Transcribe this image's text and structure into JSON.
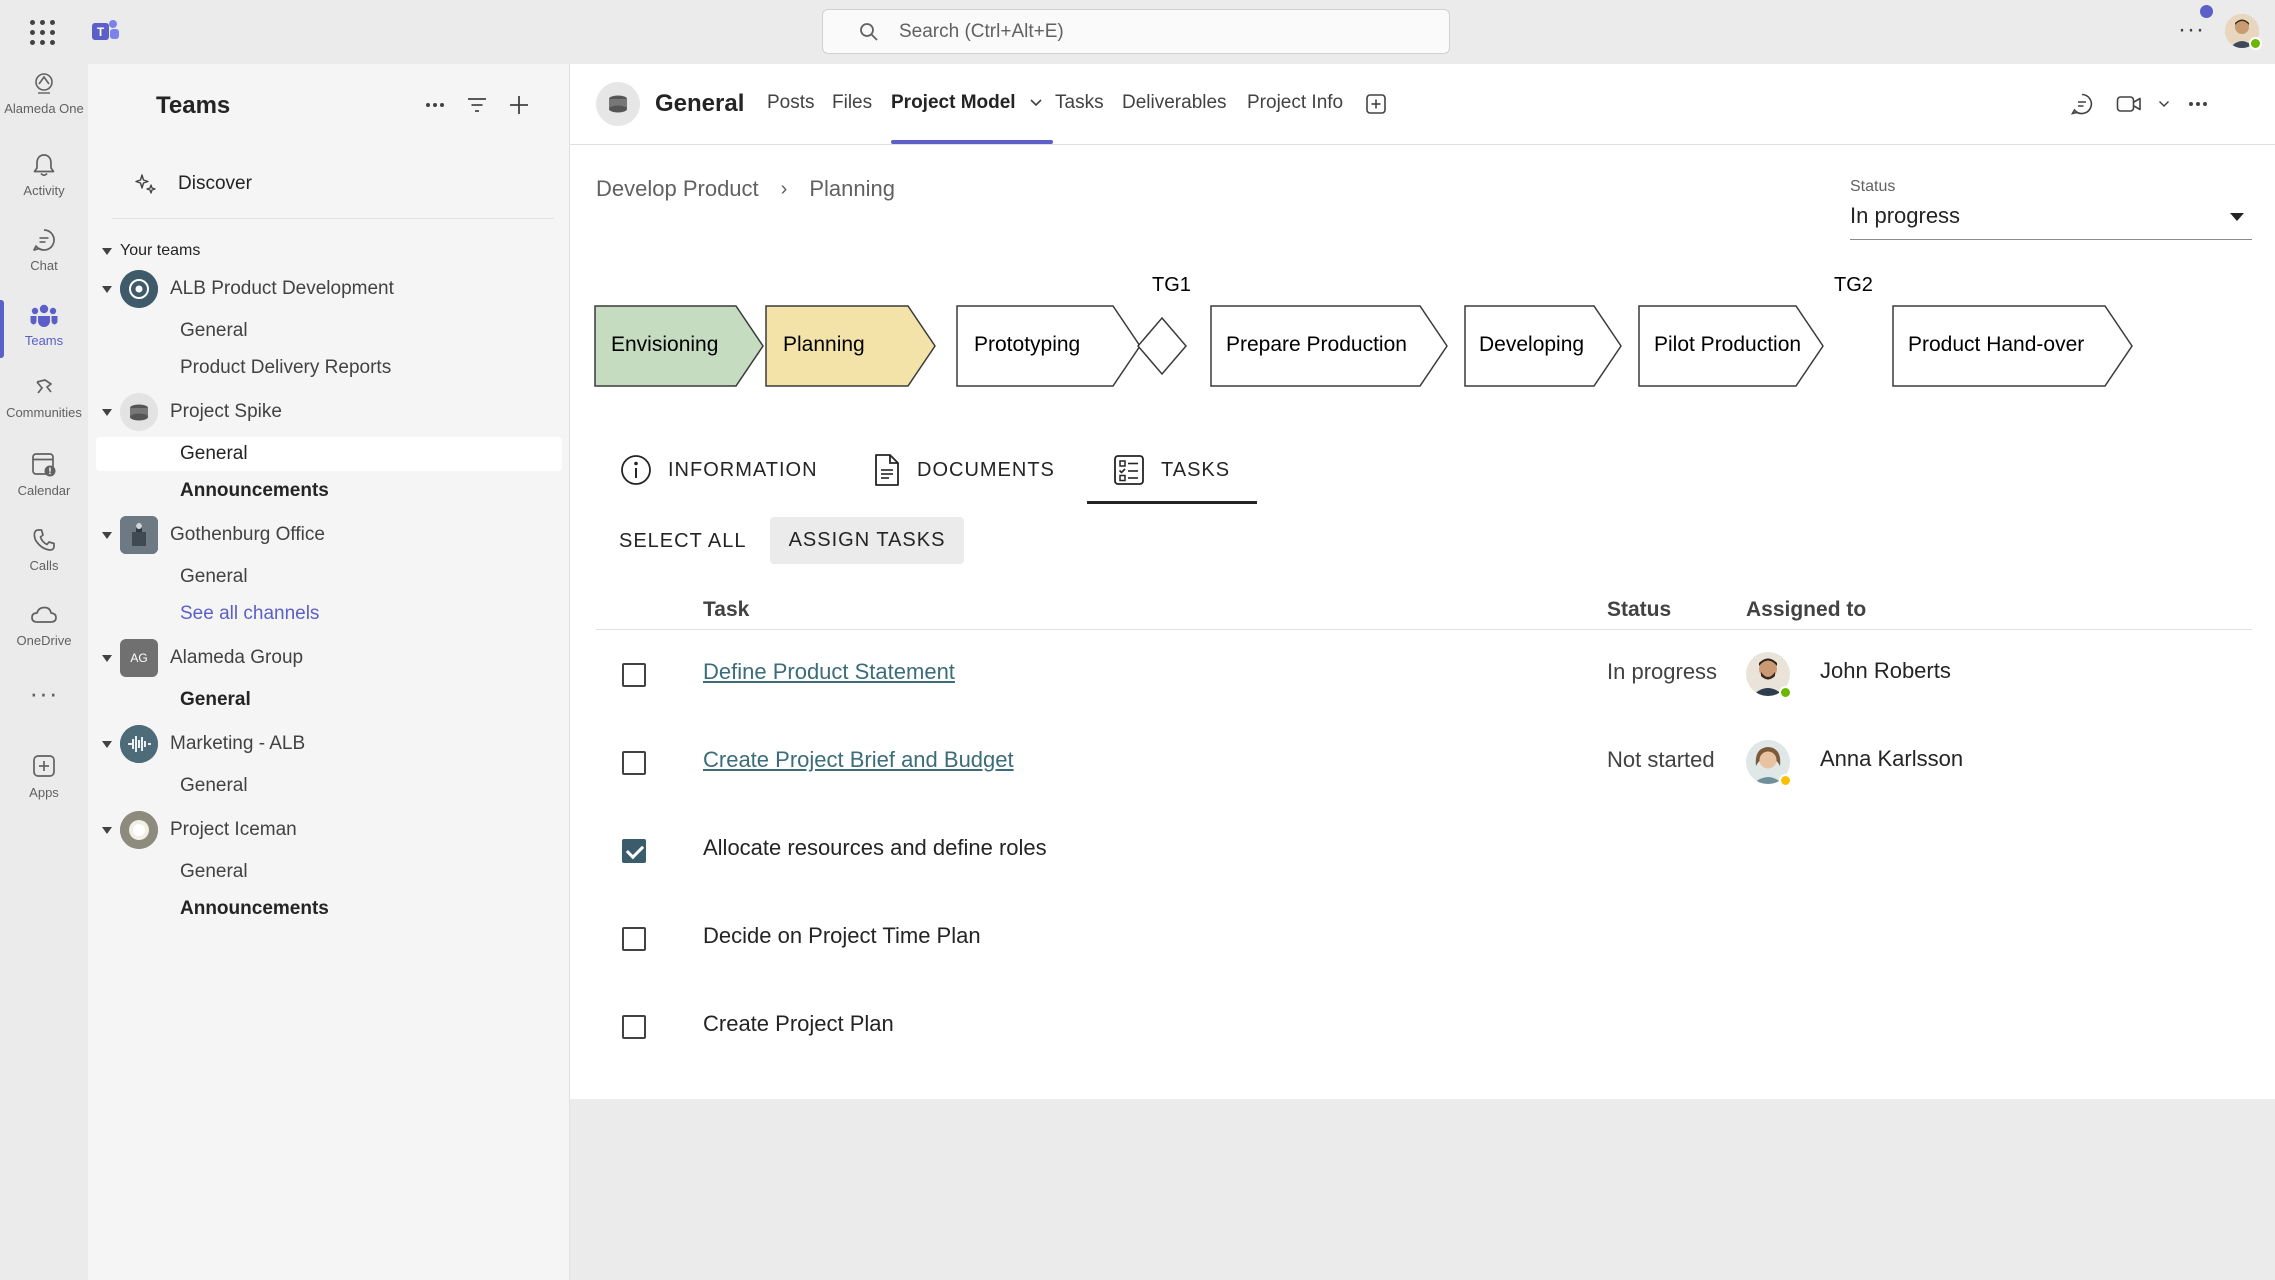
{
  "topbar": {
    "search_placeholder": "Search (Ctrl+Alt+E)",
    "more_label": "···"
  },
  "rail": {
    "items": [
      {
        "label": "Alameda One",
        "icon": "alameda-logo-icon"
      },
      {
        "label": "Activity",
        "icon": "bell-icon"
      },
      {
        "label": "Chat",
        "icon": "chat-icon"
      },
      {
        "label": "Teams",
        "icon": "teams-icon",
        "active": true
      },
      {
        "label": "Communities",
        "icon": "communities-icon"
      },
      {
        "label": "Calendar",
        "icon": "calendar-icon"
      },
      {
        "label": "Calls",
        "icon": "phone-icon"
      },
      {
        "label": "OneDrive",
        "icon": "cloud-icon"
      },
      {
        "label": "···",
        "icon": "more-icon"
      },
      {
        "label": "Apps",
        "icon": "add-apps-icon"
      }
    ]
  },
  "teams_panel": {
    "title": "Teams",
    "discover": "Discover",
    "section": "Your teams",
    "teams": [
      {
        "name": "ALB Product Development",
        "channels": [
          {
            "name": "General"
          },
          {
            "name": "Product Delivery Reports"
          }
        ]
      },
      {
        "name": "Project Spike",
        "channels": [
          {
            "name": "General",
            "selected": true
          },
          {
            "name": "Announcements",
            "bold": true
          }
        ]
      },
      {
        "name": "Gothenburg Office",
        "channels": [
          {
            "name": "General"
          },
          {
            "name": "See all channels",
            "link": true
          }
        ]
      },
      {
        "name": "Alameda Group",
        "initials": "AG",
        "channels": [
          {
            "name": "General",
            "bold": true
          }
        ]
      },
      {
        "name": "Marketing - ALB",
        "channels": [
          {
            "name": "General"
          }
        ]
      },
      {
        "name": "Project Iceman",
        "channels": [
          {
            "name": "General"
          },
          {
            "name": "Announcements",
            "bold": true
          }
        ]
      }
    ]
  },
  "channel": {
    "name": "General",
    "tabs": [
      "Posts",
      "Files",
      "Project Model",
      "Tasks",
      "Deliverables",
      "Project Info"
    ],
    "active_tab": "Project Model"
  },
  "project_model": {
    "breadcrumb": [
      "Develop Product",
      "Planning"
    ],
    "status_label": "Status",
    "status_value": "In progress",
    "phases": [
      {
        "label": "Envisioning",
        "state": "done",
        "color": "#c5dcc1"
      },
      {
        "label": "Planning",
        "state": "current",
        "color": "#f3e3a8"
      },
      {
        "label": "Prototyping",
        "state": "todo"
      },
      {
        "label": "Prepare Production",
        "state": "todo"
      },
      {
        "label": "Developing",
        "state": "todo"
      },
      {
        "label": "Pilot Production",
        "state": "todo"
      },
      {
        "label": "Product Hand-over",
        "state": "todo"
      }
    ],
    "gates": [
      "TG1",
      "TG2"
    ],
    "subtabs": [
      "INFORMATION",
      "DOCUMENTS",
      "TASKS"
    ],
    "active_subtab": "TASKS",
    "actions": {
      "select_all": "SELECT ALL",
      "assign_tasks": "ASSIGN TASKS"
    },
    "table": {
      "headers": {
        "task": "Task",
        "status": "Status",
        "assigned": "Assigned to"
      },
      "rows": [
        {
          "task": "Define Product Statement",
          "link": true,
          "status": "In progress",
          "assignee": "John Roberts",
          "checked": false,
          "presence": "available"
        },
        {
          "task": "Create Project Brief and Budget",
          "link": true,
          "status": "Not started",
          "assignee": "Anna Karlsson",
          "checked": false,
          "presence": "away"
        },
        {
          "task": "Allocate resources and define roles",
          "link": false,
          "status": "",
          "assignee": "",
          "checked": true
        },
        {
          "task": "Decide on Project Time Plan",
          "link": false,
          "status": "",
          "assignee": "",
          "checked": false
        },
        {
          "task": "Create Project Plan",
          "link": false,
          "status": "",
          "assignee": "",
          "checked": false
        }
      ]
    }
  },
  "colors": {
    "accent": "#5b5fc7",
    "task_link": "#3b6c7a",
    "checkbox_checked": "#3b5d6b"
  }
}
